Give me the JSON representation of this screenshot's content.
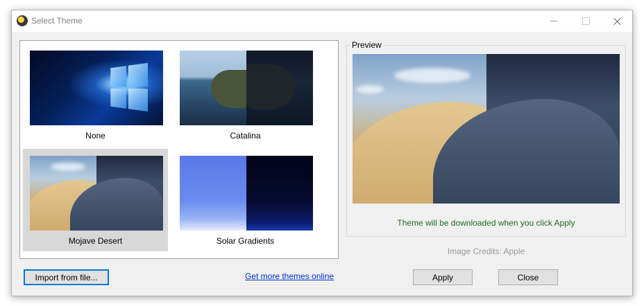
{
  "window": {
    "title": "Select Theme",
    "controls": {
      "minimize": "minimize-icon",
      "maximize": "maximize-icon",
      "close": "close-icon"
    }
  },
  "themes": [
    {
      "name": "None",
      "selected": false
    },
    {
      "name": "Catalina",
      "selected": false
    },
    {
      "name": "Mojave Desert",
      "selected": true
    },
    {
      "name": "Solar Gradients",
      "selected": false
    }
  ],
  "preview": {
    "legend": "Preview",
    "note": "Theme will be downloaded when you click Apply",
    "credits": "Image Credits: Apple"
  },
  "buttons": {
    "import": "Import from file...",
    "more_link": "Get more themes online",
    "apply": "Apply",
    "close": "Close"
  },
  "colors": {
    "note_green": "#1e6e1e",
    "link_blue": "#0033cc",
    "focus_border": "#0078d7",
    "selected_tile": "#d8d8d8"
  }
}
